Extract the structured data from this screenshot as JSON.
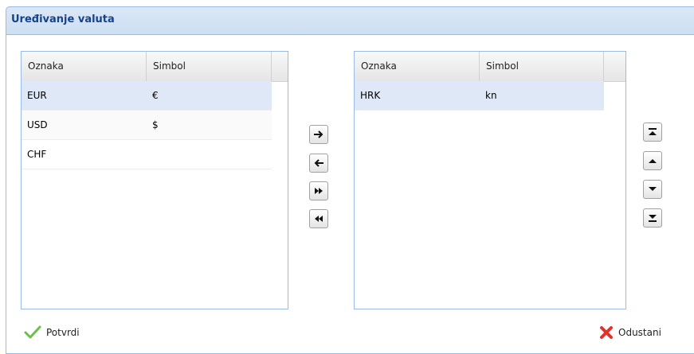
{
  "window": {
    "title": "Uređivanje valuta"
  },
  "available": {
    "columns": [
      "Oznaka",
      "Simbol"
    ],
    "rows": [
      {
        "code": "EUR",
        "symbol": "€",
        "selected": true
      },
      {
        "code": "USD",
        "symbol": "$",
        "selected": false
      },
      {
        "code": "CHF",
        "symbol": "",
        "selected": false
      }
    ]
  },
  "chosen": {
    "columns": [
      "Oznaka",
      "Simbol"
    ],
    "rows": [
      {
        "code": "HRK",
        "symbol": "kn",
        "selected": true
      }
    ]
  },
  "transfer_buttons": [
    {
      "name": "move-right-icon"
    },
    {
      "name": "move-left-icon"
    },
    {
      "name": "move-all-right-icon"
    },
    {
      "name": "move-all-left-icon"
    }
  ],
  "order_buttons": [
    {
      "name": "move-top-icon"
    },
    {
      "name": "move-up-icon"
    },
    {
      "name": "move-down-icon"
    },
    {
      "name": "move-bottom-icon"
    }
  ],
  "footer": {
    "confirm_label": "Potvrdi",
    "cancel_label": "Odustani"
  },
  "colors": {
    "title": "#15428b",
    "selection": "#dfe8f6",
    "border": "#99bbe8",
    "confirm_icon": "#6cc04a",
    "cancel_icon": "#e0332a"
  }
}
